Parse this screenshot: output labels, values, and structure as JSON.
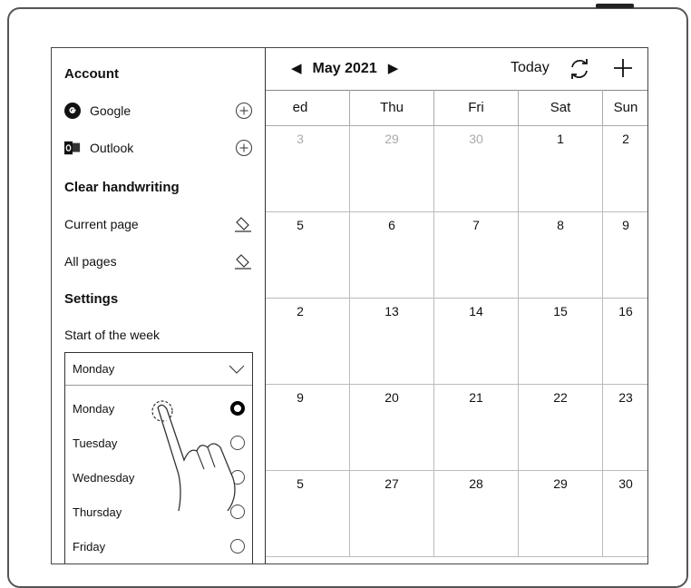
{
  "calendar": {
    "month_label": "May 2021",
    "prev_icon": "triangle-left-icon",
    "next_icon": "triangle-right-icon",
    "today_label": "Today",
    "sync_icon": "sync-icon",
    "add_icon": "plus-icon",
    "weekdays": [
      "ed",
      "Thu",
      "Fri",
      "Sat",
      "Sun"
    ],
    "weeks": [
      [
        "3",
        "29",
        "30",
        "1",
        "2"
      ],
      [
        "5",
        "6",
        "7",
        "8",
        "9"
      ],
      [
        "2",
        "13",
        "14",
        "15",
        "16"
      ],
      [
        "9",
        "20",
        "21",
        "22",
        "23"
      ],
      [
        "5",
        "27",
        "28",
        "29",
        "30"
      ]
    ]
  },
  "panel": {
    "account_title": "Account",
    "accounts": [
      {
        "label": "Google",
        "icon": "google-icon",
        "action_icon": "add-circle-icon"
      },
      {
        "label": "Outlook",
        "icon": "outlook-icon",
        "action_icon": "add-circle-icon"
      }
    ],
    "clear_title": "Clear handwriting",
    "clear_items": [
      {
        "label": "Current page",
        "icon": "eraser-icon"
      },
      {
        "label": "All pages",
        "icon": "eraser-icon"
      }
    ],
    "settings_title": "Settings",
    "start_week_label": "Start of the week",
    "dropdown": {
      "selected": "Monday",
      "options": [
        "Monday",
        "Tuesday",
        "Wednesday",
        "Thursday",
        "Friday"
      ],
      "checked_index": 0
    }
  }
}
